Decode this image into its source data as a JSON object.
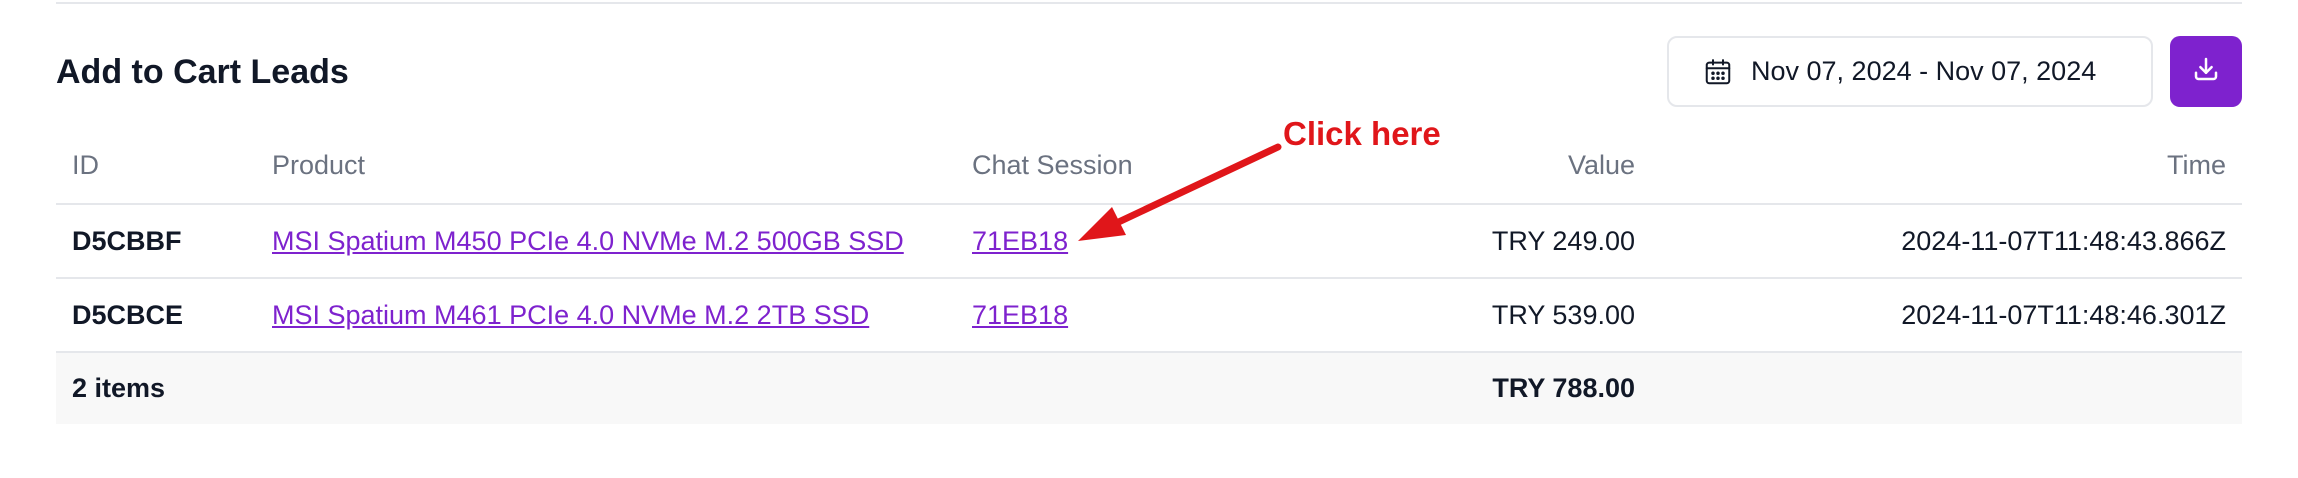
{
  "header": {
    "title": "Add to Cart Leads",
    "date_range": "Nov 07, 2024 - Nov 07, 2024"
  },
  "icons": {
    "date": "calendar-icon",
    "download": "download-icon"
  },
  "colors": {
    "accent": "#7e22ce",
    "annotation": "#e0161a"
  },
  "table": {
    "columns": [
      "ID",
      "Product",
      "Chat Session",
      "Value",
      "Time"
    ],
    "rows": [
      {
        "id": "D5CBBF",
        "product": "MSI Spatium M450 PCIe 4.0 NVMe M.2 500GB SSD",
        "chat_session": "71EB18",
        "value": "TRY 249.00",
        "time": "2024-11-07T11:48:43.866Z"
      },
      {
        "id": "D5CBCE",
        "product": "MSI Spatium M461 PCIe 4.0 NVMe M.2 2TB SSD",
        "chat_session": "71EB18",
        "value": "TRY 539.00",
        "time": "2024-11-07T11:48:46.301Z"
      }
    ],
    "footer": {
      "count": "2 items",
      "total": "TRY 788.00"
    }
  },
  "annotation": {
    "text": "Click here"
  }
}
